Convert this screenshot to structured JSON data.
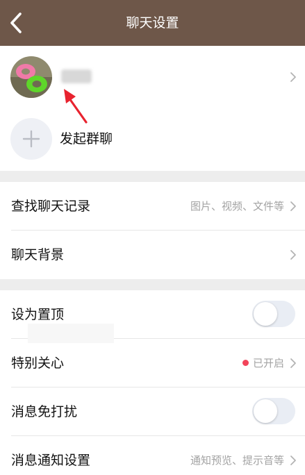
{
  "header": {
    "title": "聊天设置"
  },
  "contact": {
    "add_group_label": "发起群聊"
  },
  "rows": {
    "find_history": {
      "label": "查找聊天记录",
      "hint": "图片、视频、文件等"
    },
    "background": {
      "label": "聊天背景"
    },
    "pin": {
      "label": "设为置顶",
      "on": false
    },
    "special_care": {
      "label": "特别关心",
      "hint": "已开启"
    },
    "dnd": {
      "label": "消息免打扰",
      "on": false
    },
    "notify": {
      "label": "消息通知设置",
      "hint": "通知预览、提示音等"
    }
  },
  "colors": {
    "header_bg": "#6e5749",
    "accent_dot": "#f2445a",
    "annotation_arrow": "#e8232f"
  }
}
